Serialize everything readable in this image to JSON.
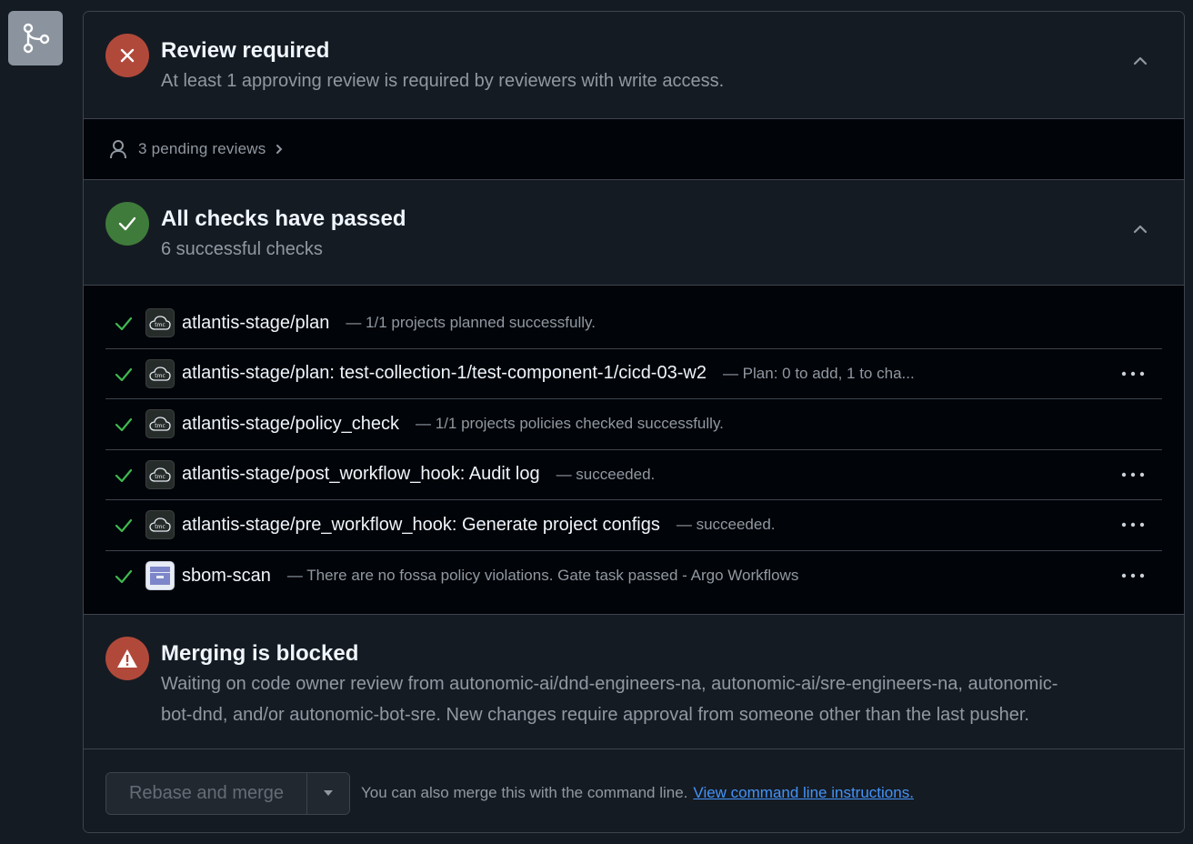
{
  "review": {
    "title": "Review required",
    "subtitle": "At least 1 approving review is required by reviewers with write access.",
    "status_icon": "x-icon",
    "pending_label": "3 pending reviews"
  },
  "checks": {
    "title": "All checks have passed",
    "subtitle": "6 successful checks",
    "status_icon": "check-icon",
    "items": [
      {
        "name": "atlantis-stage/plan",
        "desc": "— 1/1 projects planned successfully.",
        "app": "tmc",
        "menu": false
      },
      {
        "name": "atlantis-stage/plan: test-collection-1/test-component-1/cicd-03-w2",
        "desc": "— Plan: 0 to add, 1 to cha...",
        "app": "tmc",
        "menu": true
      },
      {
        "name": "atlantis-stage/policy_check",
        "desc": "— 1/1 projects policies checked successfully.",
        "app": "tmc",
        "menu": false
      },
      {
        "name": "atlantis-stage/post_workflow_hook: Audit log",
        "desc": "— succeeded.",
        "app": "tmc",
        "menu": true
      },
      {
        "name": "atlantis-stage/pre_workflow_hook: Generate project configs",
        "desc": "— succeeded.",
        "app": "tmc",
        "menu": true
      },
      {
        "name": "sbom-scan",
        "desc": "— There are no fossa policy violations. Gate task passed - Argo Workflows",
        "app": "sbom",
        "menu": true
      }
    ]
  },
  "blocked": {
    "title": "Merging is blocked",
    "text_line1": "Waiting on code owner review from autonomic-ai/dnd-engineers-na, autonomic-ai/sre-engineers-na, autonomic-",
    "text_line2": "bot-dnd, and/or autonomic-bot-sre. New changes require approval from someone other than the last pusher.",
    "status_icon": "alert-icon"
  },
  "footer": {
    "merge_button": "Rebase and merge",
    "cli_text": "You can also merge this with the command line.",
    "cli_link": "View command line instructions."
  },
  "colors": {
    "red": "#b1493a",
    "green": "#3f7b3a",
    "check_tick": "#3fb950",
    "link": "#4493f8"
  }
}
